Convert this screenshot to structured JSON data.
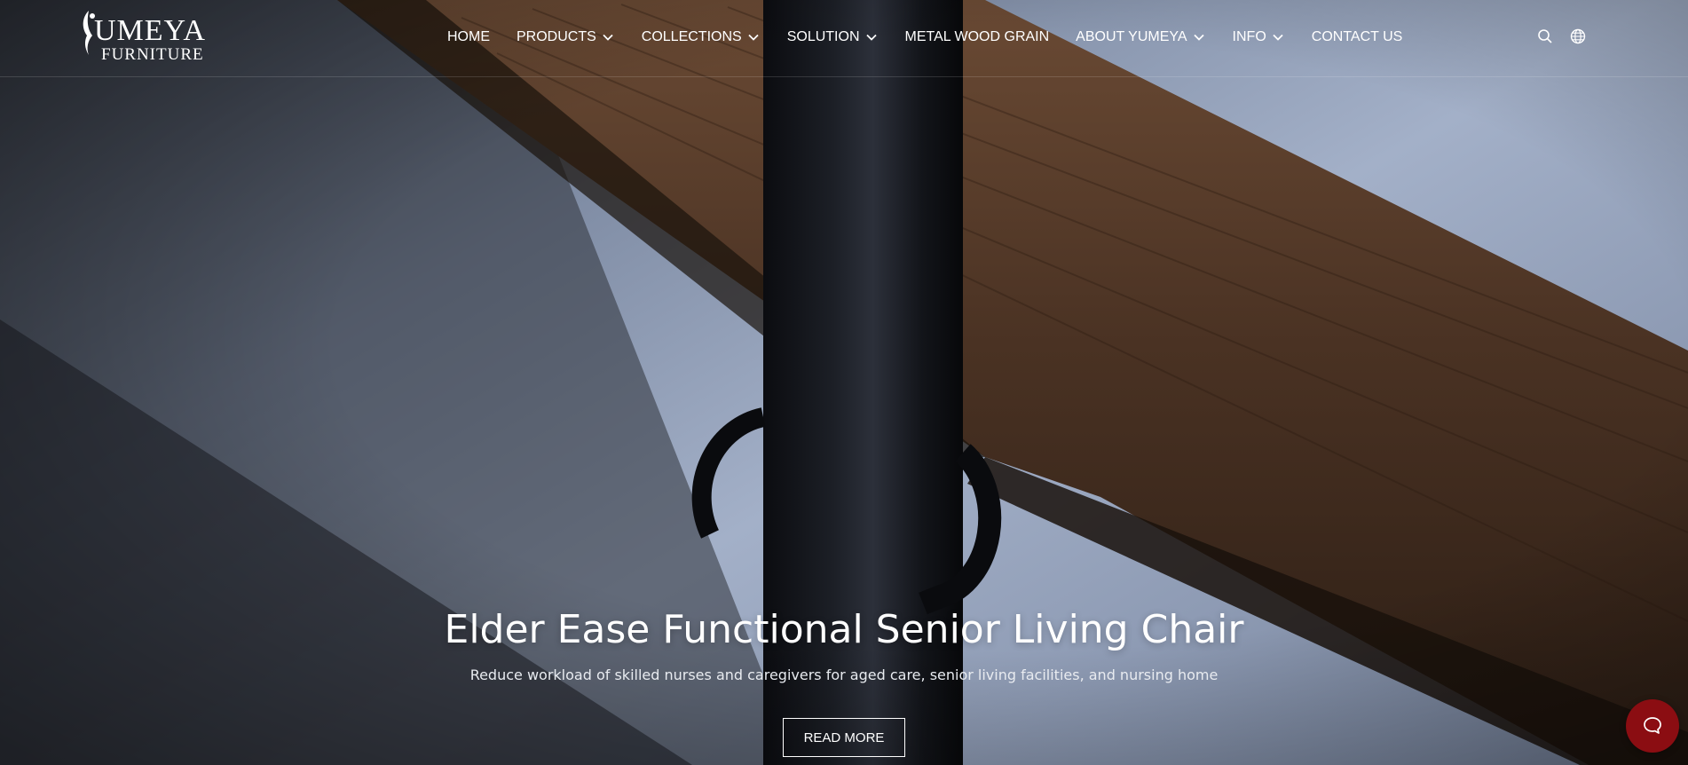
{
  "brand": {
    "name": "UMEYA",
    "sub": "FURNITURE"
  },
  "nav": {
    "items": [
      {
        "label": "HOME",
        "dropdown": false
      },
      {
        "label": "PRODUCTS",
        "dropdown": true
      },
      {
        "label": "COLLECTIONS",
        "dropdown": true
      },
      {
        "label": "SOLUTION",
        "dropdown": true
      },
      {
        "label": "METAL WOOD GRAIN",
        "dropdown": false
      },
      {
        "label": "ABOUT YUMEYA",
        "dropdown": true
      },
      {
        "label": "INFO",
        "dropdown": true
      },
      {
        "label": "CONTACT US",
        "dropdown": false
      }
    ]
  },
  "header_icons": [
    "search-icon",
    "globe-icon"
  ],
  "hero": {
    "title": "Elder Ease Functional Senior Living Chair",
    "subtitle": "Reduce workload of skilled nurses and caregivers for aged care, senior living facilities, and nursing home",
    "cta_label": "READ MORE"
  },
  "chat": {
    "icon": "chat-bubble-icon",
    "color": "#8b0d12"
  },
  "colors": {
    "text": "#ffffff",
    "accent": "#8b0d12"
  }
}
